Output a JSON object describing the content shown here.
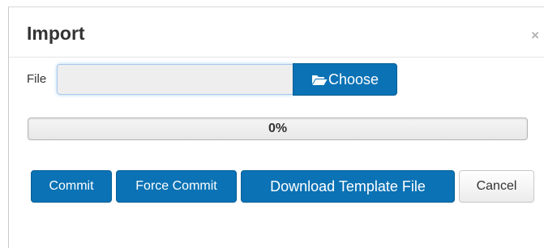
{
  "dialog": {
    "title": "Import",
    "close_label": "×"
  },
  "file": {
    "label": "File",
    "value": "",
    "choose_label": "Choose",
    "choose_icon": "folder-open-icon"
  },
  "progress": {
    "value": 0,
    "text": "0%"
  },
  "buttons": {
    "commit": "Commit",
    "force_commit": "Force Commit",
    "download_template": "Download Template File",
    "cancel": "Cancel"
  },
  "colors": {
    "primary": "#0a72b5",
    "title_text": "#333333",
    "close_icon": "#b3b3b3"
  }
}
